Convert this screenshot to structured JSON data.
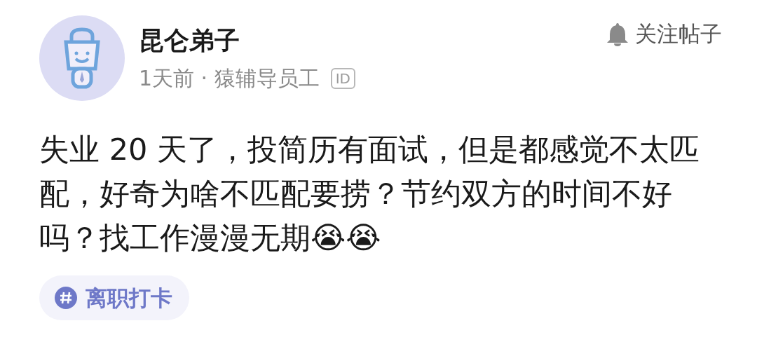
{
  "author": {
    "name": "昆仑弟子",
    "meta": "1天前 · 猿辅导员工",
    "badge": "ID"
  },
  "follow": {
    "label": "关注帖子"
  },
  "post": {
    "text": "失业 20 天了，投简历有面试，但是都感觉不太匹配，好奇为啥不匹配要捞？节约双方的时间不好吗？找工作漫漫无期😭😭"
  },
  "tags": [
    {
      "label": "离职打卡"
    }
  ]
}
